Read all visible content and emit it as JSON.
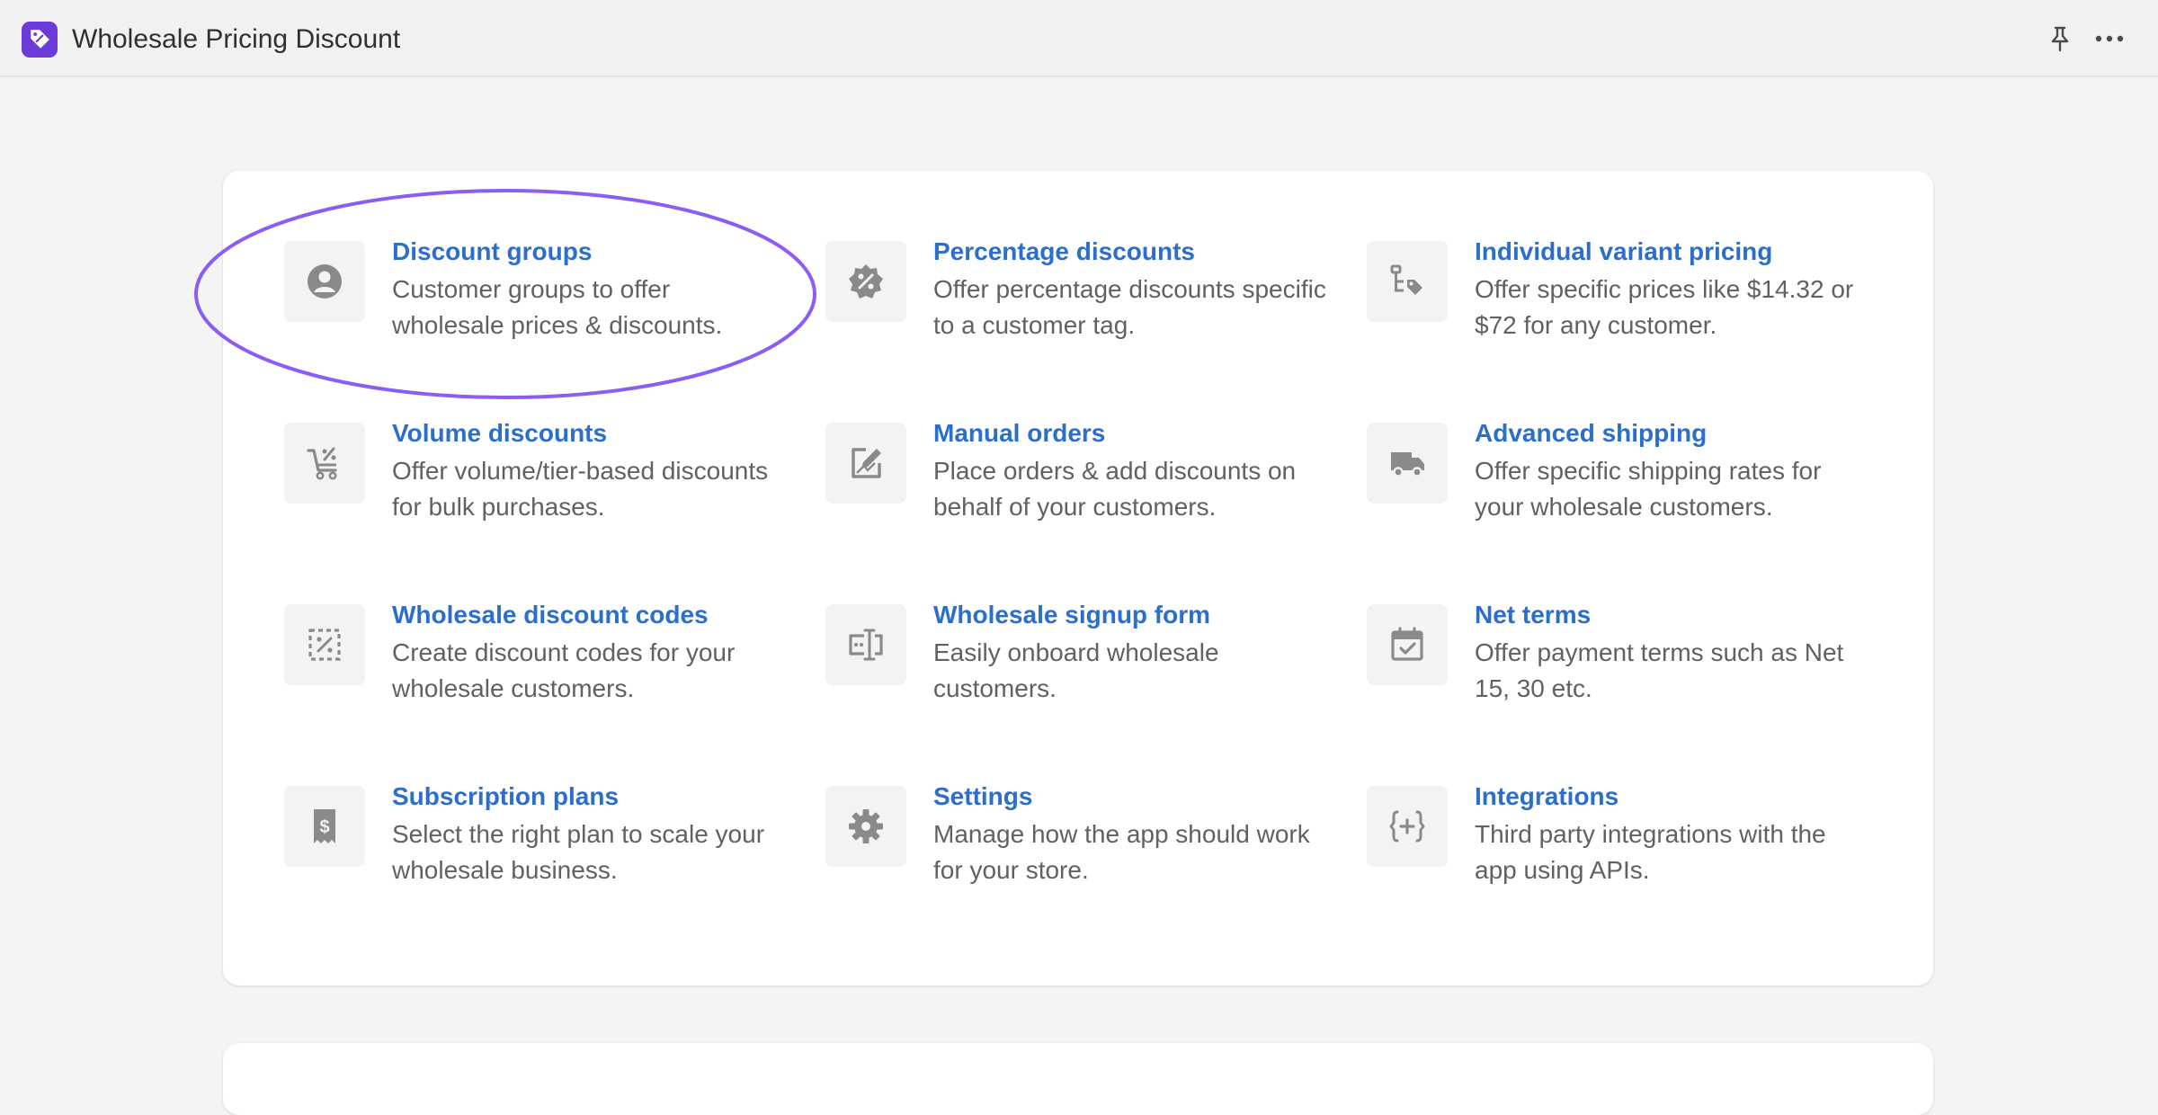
{
  "app": {
    "title": "Wholesale Pricing Discount",
    "brand_color": "#6c3ad8",
    "link_color": "#2c6ecb",
    "highlight_color": "#8b5cf6"
  },
  "tiles": [
    {
      "title": "Discount groups",
      "desc": "Customer groups to offer wholesale prices & discounts.",
      "icon": "person-circle-icon"
    },
    {
      "title": "Percentage discounts",
      "desc": "Offer percentage discounts specific to a customer tag.",
      "icon": "percent-badge-icon"
    },
    {
      "title": "Individual variant pricing",
      "desc": "Offer specific prices like $14.32 or $72 for any customer.",
      "icon": "variant-price-tag-icon"
    },
    {
      "title": "Volume discounts",
      "desc": "Offer volume/tier-based discounts for bulk purchases.",
      "icon": "cart-discount-icon"
    },
    {
      "title": "Manual orders",
      "desc": "Place orders & add discounts on behalf of your customers.",
      "icon": "edit-order-icon"
    },
    {
      "title": "Advanced shipping",
      "desc": "Offer specific shipping rates for your wholesale customers.",
      "icon": "truck-icon"
    },
    {
      "title": "Wholesale discount codes",
      "desc": "Create discount codes for your wholesale customers.",
      "icon": "discount-code-icon"
    },
    {
      "title": "Wholesale signup form",
      "desc": "Easily onboard wholesale customers.",
      "icon": "form-field-icon"
    },
    {
      "title": "Net terms",
      "desc": "Offer payment terms such as Net 15, 30 etc.",
      "icon": "calendar-check-icon"
    },
    {
      "title": "Subscription plans",
      "desc": "Select the right plan to scale your wholesale business.",
      "icon": "receipt-dollar-icon"
    },
    {
      "title": "Settings",
      "desc": "Manage how the app should work for your store.",
      "icon": "gear-icon"
    },
    {
      "title": "Integrations",
      "desc": "Third party integrations with the app using APIs.",
      "icon": "code-braces-icon"
    }
  ],
  "icon_color": "#8a8a8a"
}
